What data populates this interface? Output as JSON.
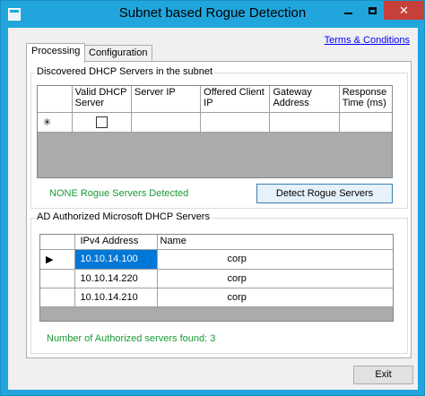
{
  "window": {
    "title": "Subnet based Rogue Detection",
    "close_glyph": "✕"
  },
  "terms_link": "Terms & Conditions",
  "tabs": [
    {
      "label": "Processing",
      "active": true
    },
    {
      "label": "Configuration",
      "active": false
    }
  ],
  "discovered": {
    "group_title": "Discovered DHCP Servers in the subnet",
    "columns": [
      "Valid DHCP Server",
      "Server IP",
      "Offered Client IP",
      "Gateway Address",
      "Response Time (ms)"
    ],
    "new_row_marker": "✳",
    "status": "NONE Rogue Servers Detected",
    "detect_button": "Detect Rogue Servers"
  },
  "authorized": {
    "group_title": "AD Authorized Microsoft DHCP Servers",
    "columns": [
      "IPv4 Address",
      "Name"
    ],
    "current_row_marker": "▶",
    "rows": [
      {
        "ip": "10.10.14.100",
        "name": "corp"
      },
      {
        "ip": "10.10.14.220",
        "name": "corp"
      },
      {
        "ip": "10.10.14.210",
        "name": "corp"
      }
    ],
    "count_text": "Number of Authorized servers found: 3"
  },
  "exit_button": "Exit",
  "colors": {
    "titlebar": "#20a6dc",
    "close_button": "#c7403a",
    "status_green": "#1a9a35",
    "selection": "#0078d7",
    "link": "#0000ff"
  }
}
